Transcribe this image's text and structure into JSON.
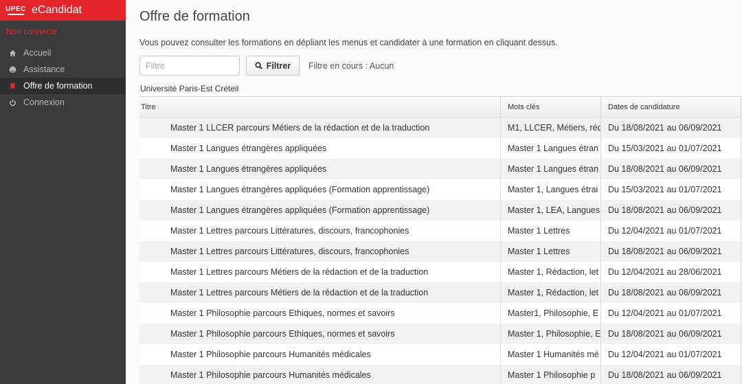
{
  "sidebar": {
    "logo_text": "UPEC",
    "app_name": "eCandidat",
    "status": "Non connecté",
    "items": [
      {
        "label": "Accueil",
        "icon": "home-icon",
        "active": false
      },
      {
        "label": "Assistance",
        "icon": "assistance-icon",
        "active": false
      },
      {
        "label": "Offre de formation",
        "icon": "bookmark-icon",
        "active": true
      },
      {
        "label": "Connexion",
        "icon": "power-icon",
        "active": false
      }
    ]
  },
  "main": {
    "title": "Offre de formation",
    "intro": "Vous pouvez consulter les formations en dépliant les menus et candidater à une formation en cliquant dessus.",
    "filter": {
      "placeholder": "Filtre",
      "value": "",
      "button_label": "Filtrer",
      "status": "Filtre en cours : Aucun"
    },
    "university": "Université Paris-Est Créteil",
    "table": {
      "headers": [
        "Titre",
        "Mots clés",
        "Dates de candidature"
      ],
      "rows": [
        {
          "titre": "Master 1 LLCER parcours Métiers de la rédaction et de la traduction",
          "mots": "M1, LLCER, Métiers, réd",
          "dates": "Du 18/08/2021 au 06/09/2021"
        },
        {
          "titre": "Master 1 Langues étrangères appliquées",
          "mots": "Master 1 Langues étran",
          "dates": "Du 15/03/2021 au 01/07/2021"
        },
        {
          "titre": "Master 1 Langues étrangères appliquées",
          "mots": "Master 1 Langues étran",
          "dates": "Du 18/08/2021 au 06/09/2021"
        },
        {
          "titre": "Master 1 Langues étrangères appliquées (Formation apprentissage)",
          "mots": "Master 1, Langues étrai",
          "dates": "Du 15/03/2021 au 01/07/2021"
        },
        {
          "titre": "Master 1 Langues étrangères appliquées (Formation apprentissage)",
          "mots": "Master 1, LEA, Langues",
          "dates": "Du 18/08/2021 au 06/09/2021"
        },
        {
          "titre": "Master 1 Lettres parcours Littératures, discours, francophonies",
          "mots": "Master 1 Lettres",
          "dates": "Du 12/04/2021 au 01/07/2021"
        },
        {
          "titre": "Master 1 Lettres parcours Littératures, discours, francophonies",
          "mots": "Master 1 Lettres",
          "dates": "Du 18/08/2021 au 06/09/2021"
        },
        {
          "titre": "Master 1 Lettres parcours Métiers de la rédaction et de la traduction",
          "mots": "Master 1, Rédaction, let",
          "dates": "Du 12/04/2021 au 28/06/2021"
        },
        {
          "titre": "Master 1 Lettres parcours Métiers de la rédaction et de la traduction",
          "mots": "Master 1, Rédaction, let",
          "dates": "Du 18/08/2021 au 06/09/2021"
        },
        {
          "titre": "Master 1 Philosophie parcours Ethiques, normes et savoirs",
          "mots": "Master1, Philosophie, E",
          "dates": "Du 12/04/2021 au 01/07/2021"
        },
        {
          "titre": "Master 1 Philosophie parcours Ethiques, normes et savoirs",
          "mots": "Master 1, Philosophie, E",
          "dates": "Du 18/08/2021 au 06/09/2021"
        },
        {
          "titre": "Master 1 Philosophie parcours Humanités médicales",
          "mots": "Master 1 Humanités mé",
          "dates": "Du 12/04/2021 au 01/07/2021"
        },
        {
          "titre": "Master 1 Philosophie parcours Humanités médicales",
          "mots": "Master 1 Philosophie p",
          "dates": "Du 18/08/2021 au 06/09/2021"
        }
      ]
    }
  }
}
